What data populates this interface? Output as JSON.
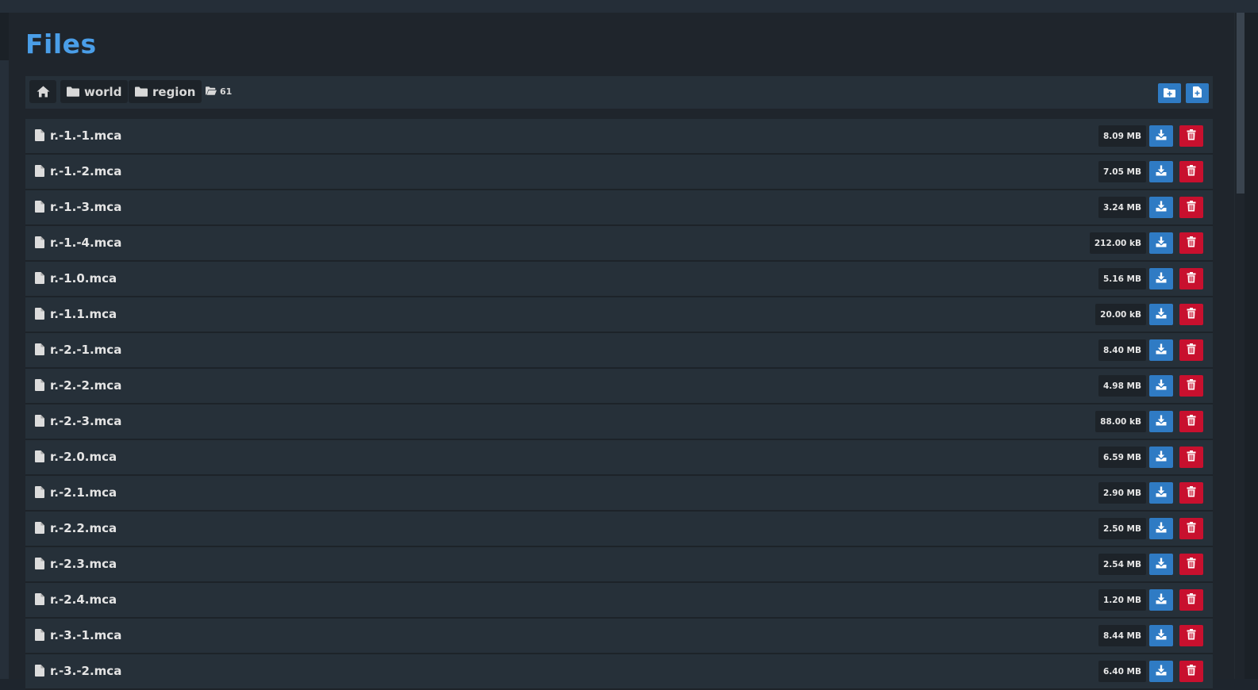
{
  "page": {
    "title": "Files"
  },
  "breadcrumb": {
    "home_icon": "home-icon",
    "items": [
      {
        "label": "world",
        "icon": "folder-icon"
      },
      {
        "label": "region",
        "icon": "folder-icon"
      }
    ],
    "count": "61",
    "count_icon": "folder-open-icon"
  },
  "toolbar": {
    "new_folder_icon": "folder-plus-icon",
    "new_file_icon": "file-plus-icon"
  },
  "colors": {
    "accent": "#4a9ee8",
    "primary_button": "#2f7bc4",
    "danger_button": "#c8102e"
  },
  "files": [
    {
      "name": "r.-1.-1.mca",
      "size": "8.09 MB"
    },
    {
      "name": "r.-1.-2.mca",
      "size": "7.05 MB"
    },
    {
      "name": "r.-1.-3.mca",
      "size": "3.24 MB"
    },
    {
      "name": "r.-1.-4.mca",
      "size": "212.00 kB"
    },
    {
      "name": "r.-1.0.mca",
      "size": "5.16 MB"
    },
    {
      "name": "r.-1.1.mca",
      "size": "20.00 kB"
    },
    {
      "name": "r.-2.-1.mca",
      "size": "8.40 MB"
    },
    {
      "name": "r.-2.-2.mca",
      "size": "4.98 MB"
    },
    {
      "name": "r.-2.-3.mca",
      "size": "88.00 kB"
    },
    {
      "name": "r.-2.0.mca",
      "size": "6.59 MB"
    },
    {
      "name": "r.-2.1.mca",
      "size": "2.90 MB"
    },
    {
      "name": "r.-2.2.mca",
      "size": "2.50 MB"
    },
    {
      "name": "r.-2.3.mca",
      "size": "2.54 MB"
    },
    {
      "name": "r.-2.4.mca",
      "size": "1.20 MB"
    },
    {
      "name": "r.-3.-1.mca",
      "size": "8.44 MB"
    },
    {
      "name": "r.-3.-2.mca",
      "size": "6.40 MB"
    }
  ]
}
